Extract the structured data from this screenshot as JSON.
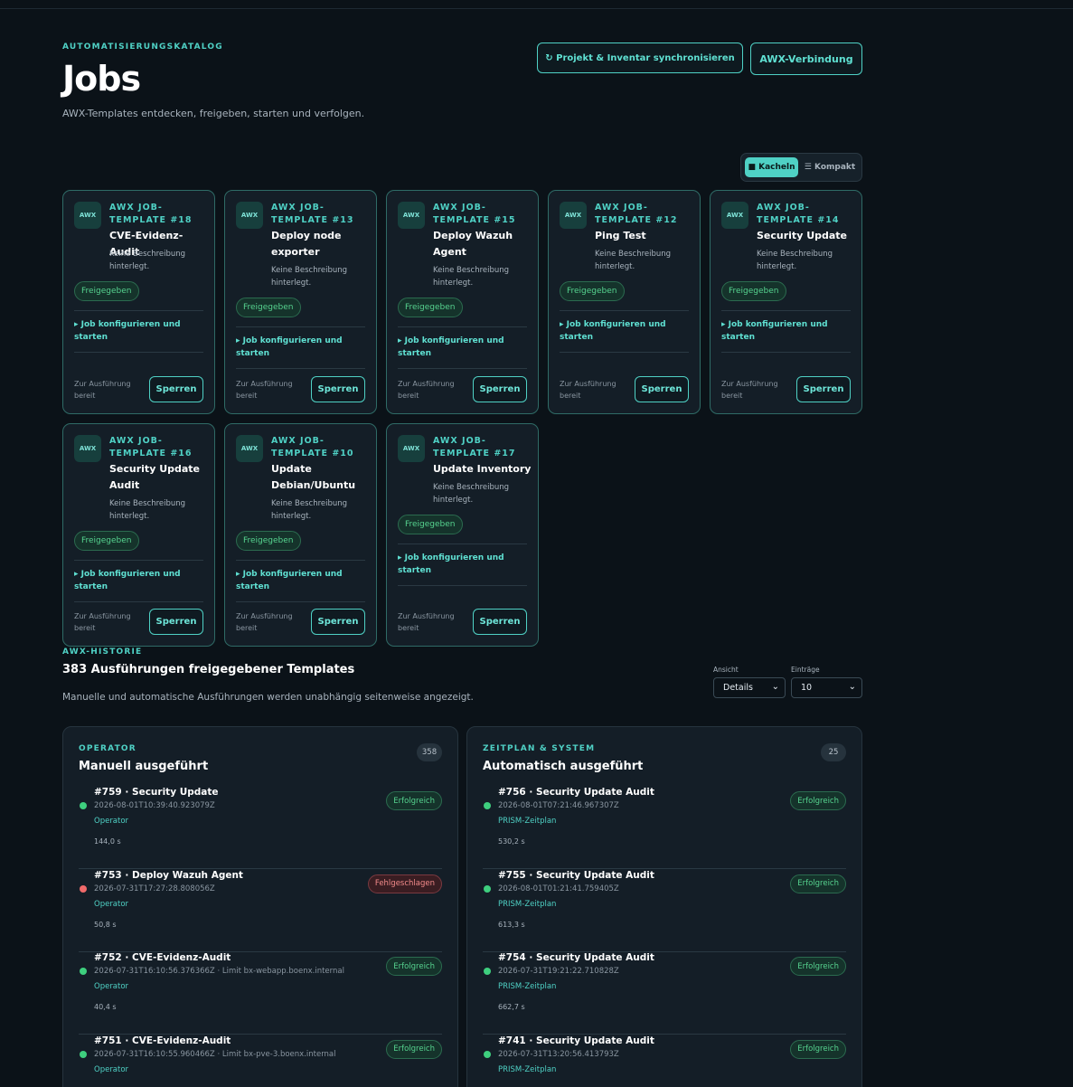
{
  "header": {
    "eyebrow": "AUTOMATISIERUNGSKATALOG",
    "title": "Jobs",
    "subtitle": "AWX-Templates entdecken, freigeben, starten und verfolgen.",
    "sync_button": "↻ Projekt & Inventar synchronisieren",
    "awx_button": "AWX-Verbindung"
  },
  "view_toggle": {
    "tiles": "■ Kacheln",
    "compact": "☰ Kompakt"
  },
  "cards": [
    {
      "logo": "AWX",
      "kicker": "AWX JOB-TEMPLATE #18",
      "title": "CVE-Evidenz-Audit",
      "desc": "Keine Beschreibung hinterlegt.",
      "badge": "Freigegeben",
      "configure": "▸ Job konfigurieren und starten",
      "ready": "Zur Ausführung bereit",
      "lock": "Sperren"
    },
    {
      "logo": "AWX",
      "kicker": "AWX JOB-TEMPLATE #13",
      "title": "Deploy node exporter",
      "desc": "Keine Beschreibung hinterlegt.",
      "badge": "Freigegeben",
      "configure": "▸ Job konfigurieren und starten",
      "ready": "Zur Ausführung bereit",
      "lock": "Sperren"
    },
    {
      "logo": "AWX",
      "kicker": "AWX JOB-TEMPLATE #15",
      "title": "Deploy Wazuh Agent",
      "desc": "Keine Beschreibung hinterlegt.",
      "badge": "Freigegeben",
      "configure": "▸ Job konfigurieren und starten",
      "ready": "Zur Ausführung bereit",
      "lock": "Sperren"
    },
    {
      "logo": "AWX",
      "kicker": "AWX JOB-TEMPLATE #12",
      "title": "Ping Test",
      "desc": "Keine Beschreibung hinterlegt.",
      "badge": "Freigegeben",
      "configure": "▸ Job konfigurieren und starten",
      "ready": "Zur Ausführung bereit",
      "lock": "Sperren"
    },
    {
      "logo": "AWX",
      "kicker": "AWX JOB-TEMPLATE #14",
      "title": "Security Update",
      "desc": "Keine Beschreibung hinterlegt.",
      "badge": "Freigegeben",
      "configure": "▸ Job konfigurieren und starten",
      "ready": "Zur Ausführung bereit",
      "lock": "Sperren"
    },
    {
      "logo": "AWX",
      "kicker": "AWX JOB-TEMPLATE #16",
      "title": "Security Update Audit",
      "desc": "Keine Beschreibung hinterlegt.",
      "badge": "Freigegeben",
      "configure": "▸ Job konfigurieren und starten",
      "ready": "Zur Ausführung bereit",
      "lock": "Sperren"
    },
    {
      "logo": "AWX",
      "kicker": "AWX JOB-TEMPLATE #10",
      "title": "Update Debian/Ubuntu",
      "desc": "Keine Beschreibung hinterlegt.",
      "badge": "Freigegeben",
      "configure": "▸ Job konfigurieren und starten",
      "ready": "Zur Ausführung bereit",
      "lock": "Sperren"
    },
    {
      "logo": "AWX",
      "kicker": "AWX JOB-TEMPLATE #17",
      "title": "Update Inventory",
      "desc": "Keine Beschreibung hinterlegt.",
      "badge": "Freigegeben",
      "configure": "▸ Job konfigurieren und starten",
      "ready": "Zur Ausführung bereit",
      "lock": "Sperren"
    }
  ],
  "history": {
    "eyebrow": "AWX-HISTORIE",
    "title": "383 Ausführungen freigegebener Templates",
    "subtitle": "Manuelle und automatische Ausführungen werden unabhängig seitenweise angezeigt.",
    "view_label": "Ansicht",
    "view_value": "Details",
    "entries_label": "Einträge",
    "entries_value": "10"
  },
  "panels": {
    "manual": {
      "eyebrow": "OPERATOR",
      "title": "Manuell ausgeführt",
      "count": "358",
      "runs": [
        {
          "title": "#759 · Security Update",
          "ts": "2026-08-01T10:39:40.923079Z",
          "source": "Operator",
          "duration": "144,0 s",
          "status": "Erfolgreich",
          "ok": true
        },
        {
          "title": "#753 · Deploy Wazuh Agent",
          "ts": "2026-07-31T17:27:28.808056Z",
          "source": "Operator",
          "duration": "50,8 s",
          "status": "Fehlgeschlagen",
          "ok": false
        },
        {
          "title": "#752 · CVE-Evidenz-Audit",
          "ts": "2026-07-31T16:10:56.376366Z · Limit bx-webapp.boenx.internal",
          "source": "Operator",
          "duration": "40,4 s",
          "status": "Erfolgreich",
          "ok": true
        },
        {
          "title": "#751 · CVE-Evidenz-Audit",
          "ts": "2026-07-31T16:10:55.960466Z · Limit bx-pve-3.boenx.internal",
          "source": "Operator",
          "duration": "",
          "status": "Erfolgreich",
          "ok": true
        }
      ]
    },
    "auto": {
      "eyebrow": "ZEITPLAN & SYSTEM",
      "title": "Automatisch ausgeführt",
      "count": "25",
      "runs": [
        {
          "title": "#756 · Security Update Audit",
          "ts": "2026-08-01T07:21:46.967307Z",
          "source": "PRISM-Zeitplan",
          "duration": "530,2 s",
          "status": "Erfolgreich",
          "ok": true
        },
        {
          "title": "#755 · Security Update Audit",
          "ts": "2026-08-01T01:21:41.759405Z",
          "source": "PRISM-Zeitplan",
          "duration": "613,3 s",
          "status": "Erfolgreich",
          "ok": true
        },
        {
          "title": "#754 · Security Update Audit",
          "ts": "2026-07-31T19:21:22.710828Z",
          "source": "PRISM-Zeitplan",
          "duration": "662,7 s",
          "status": "Erfolgreich",
          "ok": true
        },
        {
          "title": "#741 · Security Update Audit",
          "ts": "2026-07-31T13:20:56.413793Z",
          "source": "PRISM-Zeitplan",
          "duration": "",
          "status": "Erfolgreich",
          "ok": true
        }
      ]
    }
  }
}
